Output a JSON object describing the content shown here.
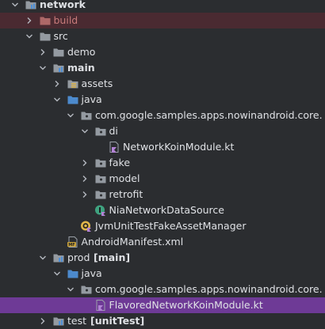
{
  "project_tree": {
    "colors": {
      "background": "#2b2d30",
      "text": "#dfe1e5",
      "excluded_row": "#4a2a31",
      "excluded_text": "#c97b7b",
      "selected_row": "#6e3a96",
      "folder": "#9aa0a8",
      "source_folder": "#4e8fd6",
      "kotlin": "#b383d6",
      "interface": "#3fa27f"
    },
    "items": [
      {
        "depth": 0,
        "expanded": true,
        "icon": "module-folder-icon",
        "label": "network",
        "bold": true
      },
      {
        "depth": 1,
        "expanded": false,
        "icon": "excluded-folder-icon",
        "label": "build",
        "excluded": true
      },
      {
        "depth": 1,
        "expanded": true,
        "icon": "folder-icon",
        "label": "src"
      },
      {
        "depth": 2,
        "expanded": false,
        "icon": "folder-icon",
        "label": "demo"
      },
      {
        "depth": 2,
        "expanded": true,
        "icon": "module-folder-icon",
        "label": "main",
        "bold": true
      },
      {
        "depth": 3,
        "expanded": false,
        "icon": "resources-folder-icon",
        "label": "assets"
      },
      {
        "depth": 3,
        "expanded": true,
        "icon": "source-folder-icon",
        "label": "java"
      },
      {
        "depth": 4,
        "expanded": true,
        "icon": "package-icon",
        "label": "com.google.samples.apps.nowinandroid.core."
      },
      {
        "depth": 5,
        "expanded": true,
        "icon": "package-icon",
        "label": "di"
      },
      {
        "depth": 6,
        "expanded": null,
        "icon": "kotlin-file-icon",
        "label": "NetworkKoinModule.kt"
      },
      {
        "depth": 5,
        "expanded": false,
        "icon": "package-icon",
        "label": "fake"
      },
      {
        "depth": 5,
        "expanded": false,
        "icon": "package-icon",
        "label": "model"
      },
      {
        "depth": 5,
        "expanded": false,
        "icon": "package-icon",
        "label": "retrofit"
      },
      {
        "depth": 5,
        "expanded": null,
        "icon": "kotlin-interface-icon",
        "label": "NiaNetworkDataSource"
      },
      {
        "depth": 4,
        "expanded": null,
        "icon": "kotlin-object-icon",
        "label": "JvmUnitTestFakeAssetManager"
      },
      {
        "depth": 3,
        "expanded": null,
        "icon": "manifest-file-icon",
        "label": "AndroidManifest.xml"
      },
      {
        "depth": 2,
        "expanded": true,
        "icon": "module-folder-icon",
        "label": "prod",
        "suffix": "[main]"
      },
      {
        "depth": 3,
        "expanded": true,
        "icon": "source-folder-icon",
        "label": "java"
      },
      {
        "depth": 4,
        "expanded": true,
        "icon": "package-icon",
        "label": "com.google.samples.apps.nowinandroid.core."
      },
      {
        "depth": 5,
        "expanded": null,
        "icon": "kotlin-file-icon",
        "label": "FlavoredNetworkKoinModule.kt",
        "selected": true
      },
      {
        "depth": 2,
        "expanded": false,
        "icon": "module-folder-icon",
        "label": "test",
        "suffix": "[unitTest]"
      }
    ]
  }
}
